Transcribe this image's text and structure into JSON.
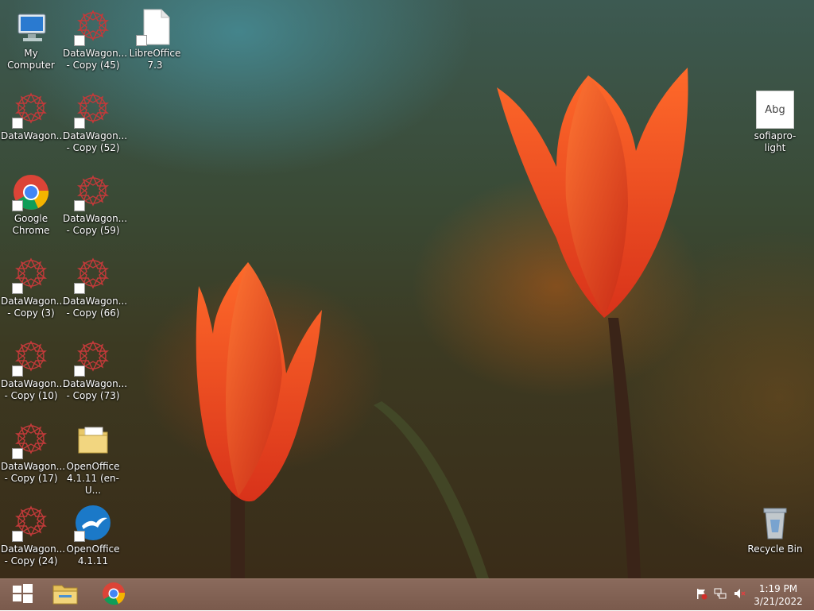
{
  "desktop": {
    "icons": [
      {
        "id": "my-computer",
        "line1": "My Computer",
        "line2": ""
      },
      {
        "id": "dw-copy-45",
        "line1": "DataWagon...",
        "line2": "- Copy (45)"
      },
      {
        "id": "libreoffice",
        "line1": "LibreOffice",
        "line2": "7.3"
      },
      {
        "id": "dw-1",
        "line1": "DataWagon...",
        "line2": ""
      },
      {
        "id": "dw-copy-52",
        "line1": "DataWagon...",
        "line2": "- Copy (52)"
      },
      {
        "id": "chrome",
        "line1": "Google",
        "line2": "Chrome"
      },
      {
        "id": "dw-copy-59",
        "line1": "DataWagon...",
        "line2": "- Copy (59)"
      },
      {
        "id": "dw-copy-3",
        "line1": "DataWagon....",
        "line2": "- Copy (3)"
      },
      {
        "id": "dw-copy-66",
        "line1": "DataWagon...",
        "line2": "- Copy (66)"
      },
      {
        "id": "dw-copy-10",
        "line1": "DataWagon...",
        "line2": "- Copy (10)"
      },
      {
        "id": "dw-copy-73",
        "line1": "DataWagon...",
        "line2": "- Copy (73)"
      },
      {
        "id": "dw-copy-17",
        "line1": "DataWagon...",
        "line2": "- Copy (17)"
      },
      {
        "id": "oo-installer",
        "line1": "OpenOffice",
        "line2": "4.1.11 (en-U..."
      },
      {
        "id": "dw-copy-24",
        "line1": "DataWagon...",
        "line2": "- Copy (24)"
      },
      {
        "id": "openoffice",
        "line1": "OpenOffice",
        "line2": "4.1.11"
      },
      {
        "id": "font-file",
        "line1": "sofiapro-light",
        "line2": "",
        "thumb": "Abg"
      },
      {
        "id": "recycle-bin",
        "line1": "Recycle Bin",
        "line2": ""
      }
    ]
  },
  "taskbar": {
    "pinned": [
      "start-button",
      "file-explorer",
      "chrome"
    ],
    "tray": [
      "action-center-flag-icon",
      "network-icon",
      "volume-muted-icon"
    ],
    "clock": {
      "time": "1:19 PM",
      "date": "3/21/2022"
    }
  },
  "colors": {
    "taskbar": "#7a5a4c",
    "datawagon_red": "#c23a3a",
    "chrome_red": "#db4437",
    "chrome_green": "#0f9d58",
    "chrome_yellow": "#f4b400",
    "chrome_blue": "#4285f4"
  }
}
